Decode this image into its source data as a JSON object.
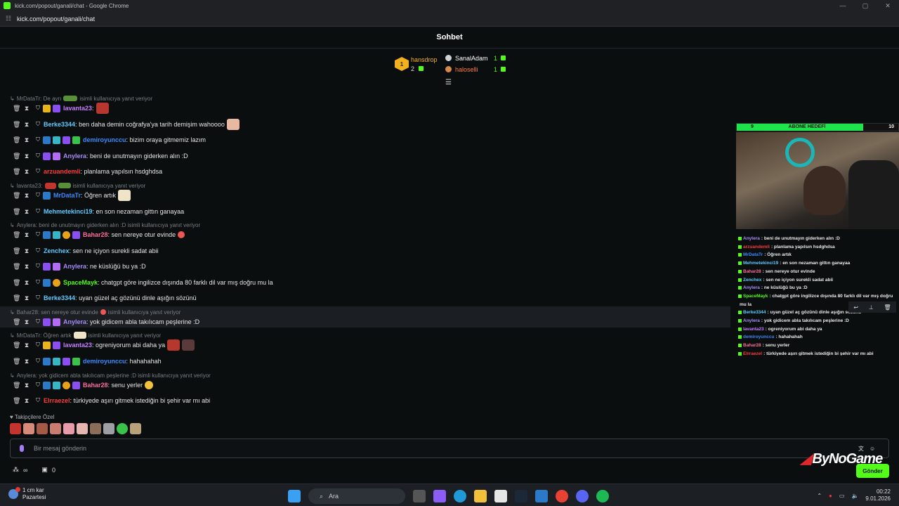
{
  "browser": {
    "window_title": "kick.com/popout/ganali/chat - Google Chrome",
    "url": "kick.com/popout/ganali/chat",
    "win_controls": [
      "—",
      "▢",
      "✕"
    ]
  },
  "header": {
    "title": "Sohbet"
  },
  "leaderboard": {
    "first": {
      "rank": "1",
      "name": "hansdrop",
      "count": "2"
    },
    "second": {
      "name": "SanalAdam",
      "count": "1"
    },
    "third": {
      "name": "haloselli",
      "count": "1"
    }
  },
  "colors": {
    "accent": "#53fc18",
    "background": "#0b0e0f"
  },
  "messages": [
    {
      "reply": "MrDataTr: De ayrı",
      "reply_suffix": "isimli kullanıcıya yanıt veriyor"
    },
    {
      "user": "lavanta23",
      "color": "#c77dff",
      "text": ""
    },
    {
      "user": "Berke3344",
      "color": "#5ecbff",
      "text": "ben daha demin coğrafya'ya tarih demişim wahoooo"
    },
    {
      "user": "demiroyunccu",
      "color": "#3a8bff",
      "text": "bizim oraya gitmemiz lazım"
    },
    {
      "user": "Anylera",
      "color": "#a88bfa",
      "text": "beni de unutmayın giderken alın :D"
    },
    {
      "user": "arzuandemli",
      "color": "#ff3b3b",
      "text": "planlama yapılsın hsdghdsa"
    },
    {
      "reply": "lavanta23:",
      "reply_suffix": "isimli kullanıcıya yanıt veriyor"
    },
    {
      "user": "MrDataTr",
      "color": "#3a8bff",
      "text": "Öğren artık"
    },
    {
      "user": "Mehmetekinci19",
      "color": "#5ecbff",
      "text": "en son nezaman gittın ganayaa"
    },
    {
      "reply": "Anylera: beni de unutmayın giderken alın :D isimli kullanıcıya yanıt veriyor",
      "reply_suffix": ""
    },
    {
      "user": "Bahar28",
      "color": "#ff6b9a",
      "text": "sen nereye otur evinde"
    },
    {
      "user": "Zenchex",
      "color": "#5ecbff",
      "text": "sen ne içiyon surekli sadat abii"
    },
    {
      "user": "Anylera",
      "color": "#a88bfa",
      "text": "ne küslüğü bu ya :D"
    },
    {
      "user": "SpaceMayk",
      "color": "#53fc18",
      "text": "chatgpt göre ingilizce dışında 80 farklı dil var mış doğru mu la"
    },
    {
      "user": "Berke3344",
      "color": "#5ecbff",
      "text": "uyan güzel aç gözünü dinle aşığın sözünü"
    },
    {
      "reply": "Bahar28: sen nereye otur evinde",
      "reply_suffix": "isimli kullanıcıya yanıt veriyor"
    },
    {
      "user": "Anylera",
      "color": "#a88bfa",
      "text": "yok gidicem abla takılıcam peşlerine :D"
    },
    {
      "reply": "MrDataTr: Öğren artık",
      "reply_suffix": "isimli kullanıcıya yanıt veriyor"
    },
    {
      "user": "lavanta23",
      "color": "#c77dff",
      "text": "ogreniyorum abi daha ya"
    },
    {
      "user": "demiroyunccu",
      "color": "#3a8bff",
      "text": "hahahahah"
    },
    {
      "reply": "Anylera: yok gidicem abla takılıcam peşlerine :D isimli kullanıcıya yanıt veriyor",
      "reply_suffix": ""
    },
    {
      "user": "Bahar28",
      "color": "#ff6b9a",
      "text": "senu yerler"
    },
    {
      "user": "Elrraezel",
      "color": "#ff3b3b",
      "text": "türkiyede aşırı gitmek istediğin bi şehir var mı abi"
    }
  ],
  "followers": {
    "label": "Takipçilere Özel"
  },
  "input": {
    "placeholder": "Bir mesaj gönderin",
    "send_label": "Gönder"
  },
  "bottom": {
    "infinity": "∞",
    "box_count": "0"
  },
  "overlay": {
    "goal_label": "ABONE HEDEFİ",
    "goal_current": "9",
    "goal_total": "10",
    "goal_progress": 0.9,
    "brand": "ByNoGame",
    "mini_lines": [
      {
        "u": "Anylera",
        "c": "#a88bfa",
        "t": ": beni de unutmayın giderken alın :D"
      },
      {
        "u": "arzuandemli",
        "c": "#ff3b3b",
        "t": ": planlama yapılsın hsdghdsa"
      },
      {
        "u": "MrDataTr",
        "c": "#3a8bff",
        "t": ": Öğren artık"
      },
      {
        "u": "Mehmetekinci19",
        "c": "#5ecbff",
        "t": ": en son nezaman gittın ganayaa"
      },
      {
        "u": "Bahar28",
        "c": "#ff6b9a",
        "t": ": sen nereye otur evinde"
      },
      {
        "u": "Zenchex",
        "c": "#5ecbff",
        "t": ": sen ne içiyon surekli sadat abii"
      },
      {
        "u": "Anylera",
        "c": "#a88bfa",
        "t": ": ne küslüğü bu ya :D"
      },
      {
        "u": "SpaceMayk",
        "c": "#53fc18",
        "t": ": chatgpt göre ingilizce dışında 80 farklı dil var mış doğru"
      },
      {
        "u": "",
        "c": "#eaeaea",
        "t": "mu la"
      },
      {
        "u": "Berke3344",
        "c": "#5ecbff",
        "t": ": uyan güzel aç gözünü dinle aşığın sözünü"
      },
      {
        "u": "Anylera",
        "c": "#a88bfa",
        "t": ": yok gidicem abla takılıcam peşlerine :D"
      },
      {
        "u": "lavanta23",
        "c": "#c77dff",
        "t": ": ogreniyorum abi daha ya"
      },
      {
        "u": "demiroyunccu",
        "c": "#3a8bff",
        "t": ": hahahahah"
      },
      {
        "u": "Bahar28",
        "c": "#ff6b9a",
        "t": ": senu yerler"
      },
      {
        "u": "Elrraezel",
        "c": "#ff3b3b",
        "t": ": türkiyede aşırı gitmek istediğin bi şehir var mı abi"
      }
    ]
  },
  "taskbar": {
    "weather_line1": "1 cm kar",
    "weather_line2": "Pazartesi",
    "search_label": "Ara",
    "time": "00:22",
    "date": "9.01.2026"
  }
}
